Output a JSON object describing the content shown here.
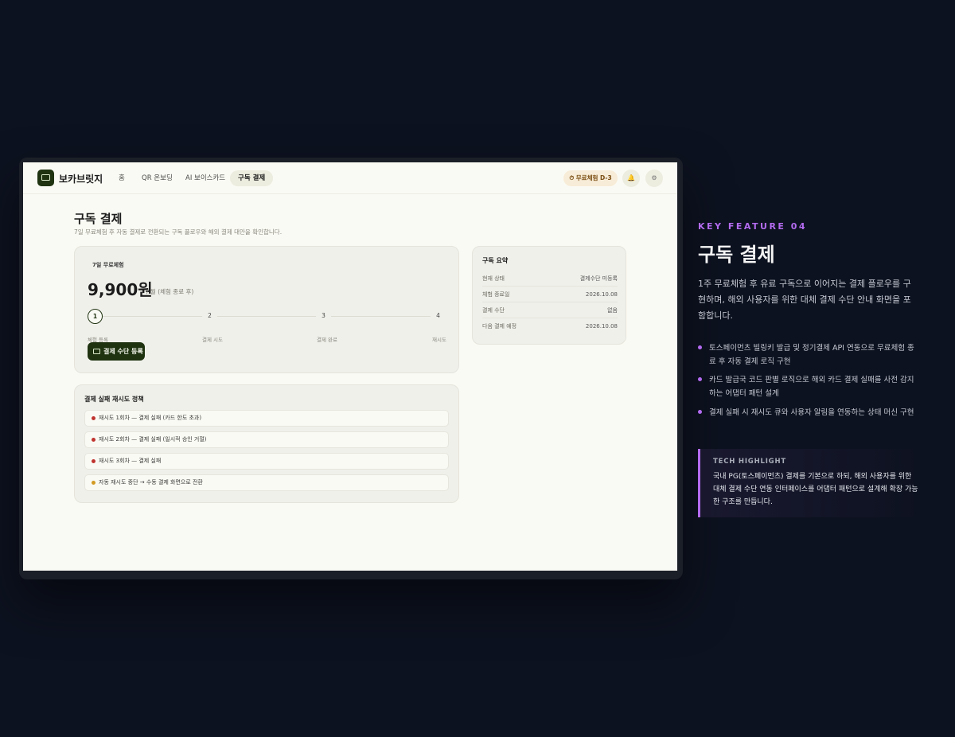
{
  "app": {
    "brand": "보카브릿지",
    "nav": [
      {
        "label": "홈"
      },
      {
        "label": "QR 온보딩"
      },
      {
        "label": "AI 보이스카드"
      },
      {
        "label": "구독 결제"
      }
    ],
    "trial_badge": "⏱ 무료체험 D-3"
  },
  "page": {
    "title": "구독 결제",
    "subtitle": "7일 무료체험 후 자동 결제로 전환되는 구독 플로우와 해외 결제 대안을 확인합니다."
  },
  "plan": {
    "tag": "7일 무료체험",
    "price": "9,900원",
    "price_unit": "/ 월 (체험 종료 후)",
    "steps": [
      {
        "num": "1",
        "label": "체험 등록"
      },
      {
        "num": "2",
        "label": "결제 시도"
      },
      {
        "num": "3",
        "label": "결제 완료"
      },
      {
        "num": "4",
        "label": "재시도"
      }
    ],
    "pay_button": "결제 수단 등록"
  },
  "summary": {
    "title": "구독 요약",
    "rows": [
      {
        "k": "현재 상태",
        "v": "결제수단 미등록"
      },
      {
        "k": "체험 종료일",
        "v": "2026.10.08"
      },
      {
        "k": "결제 수단",
        "v": "없음"
      },
      {
        "k": "다음 결제 예정",
        "v": "2026.10.08"
      }
    ]
  },
  "retry": {
    "title": "결제 실패 재시도 정책",
    "rows": [
      {
        "text": "재시도 1회차 — 결제 실패 (카드 한도 초과)"
      },
      {
        "text": "재시도 2회차 — 결제 실패 (일시적 승인 거절)"
      },
      {
        "text": "재시도 3회차 — 결제 실패"
      },
      {
        "text": "자동 재시도 중단 → 수동 결제 화면으로 전환"
      }
    ]
  },
  "feature": {
    "kicker": "KEY FEATURE 04",
    "title": "구독 결제",
    "description": "1주 무료체험 후 유료 구독으로 이어지는 결제 플로우를 구현하며, 해외 사용자를 위한 대체 결제 수단 안내 화면을 포함합니다.",
    "bullets": [
      "토스페이먼츠 빌링키 발급 및 정기결제 API 연동으로 무료체험 종료 후 자동 결제 로직 구현",
      "카드 발급국 코드 판별 로직으로 해외 카드 결제 실패를 사전 감지하는 어댑터 패턴 설계",
      "결제 실패 시 재시도 큐와 사용자 알림을 연동하는 상태 머신 구현"
    ],
    "tech_label": "TECH HIGHLIGHT",
    "tech_text": "국내 PG(토스페이먼츠) 결제를 기본으로 하되, 해외 사용자를 위한 대체 결제 수단 연동 인터페이스를 어댑터 패턴으로 설계해 확장 가능한 구조를 만듭니다."
  },
  "colors": {
    "background": "#0d1220",
    "accent_purple": "#b36bf0",
    "brand_green": "#1f3311",
    "screen_bg": "#fafaf4",
    "failure_dot": "#c0342f",
    "warning_dot": "#d29a22"
  },
  "icons": [
    "book-card-logo-icon",
    "timer-icon",
    "bell-icon",
    "settings-icon",
    "credit-card-icon"
  ]
}
